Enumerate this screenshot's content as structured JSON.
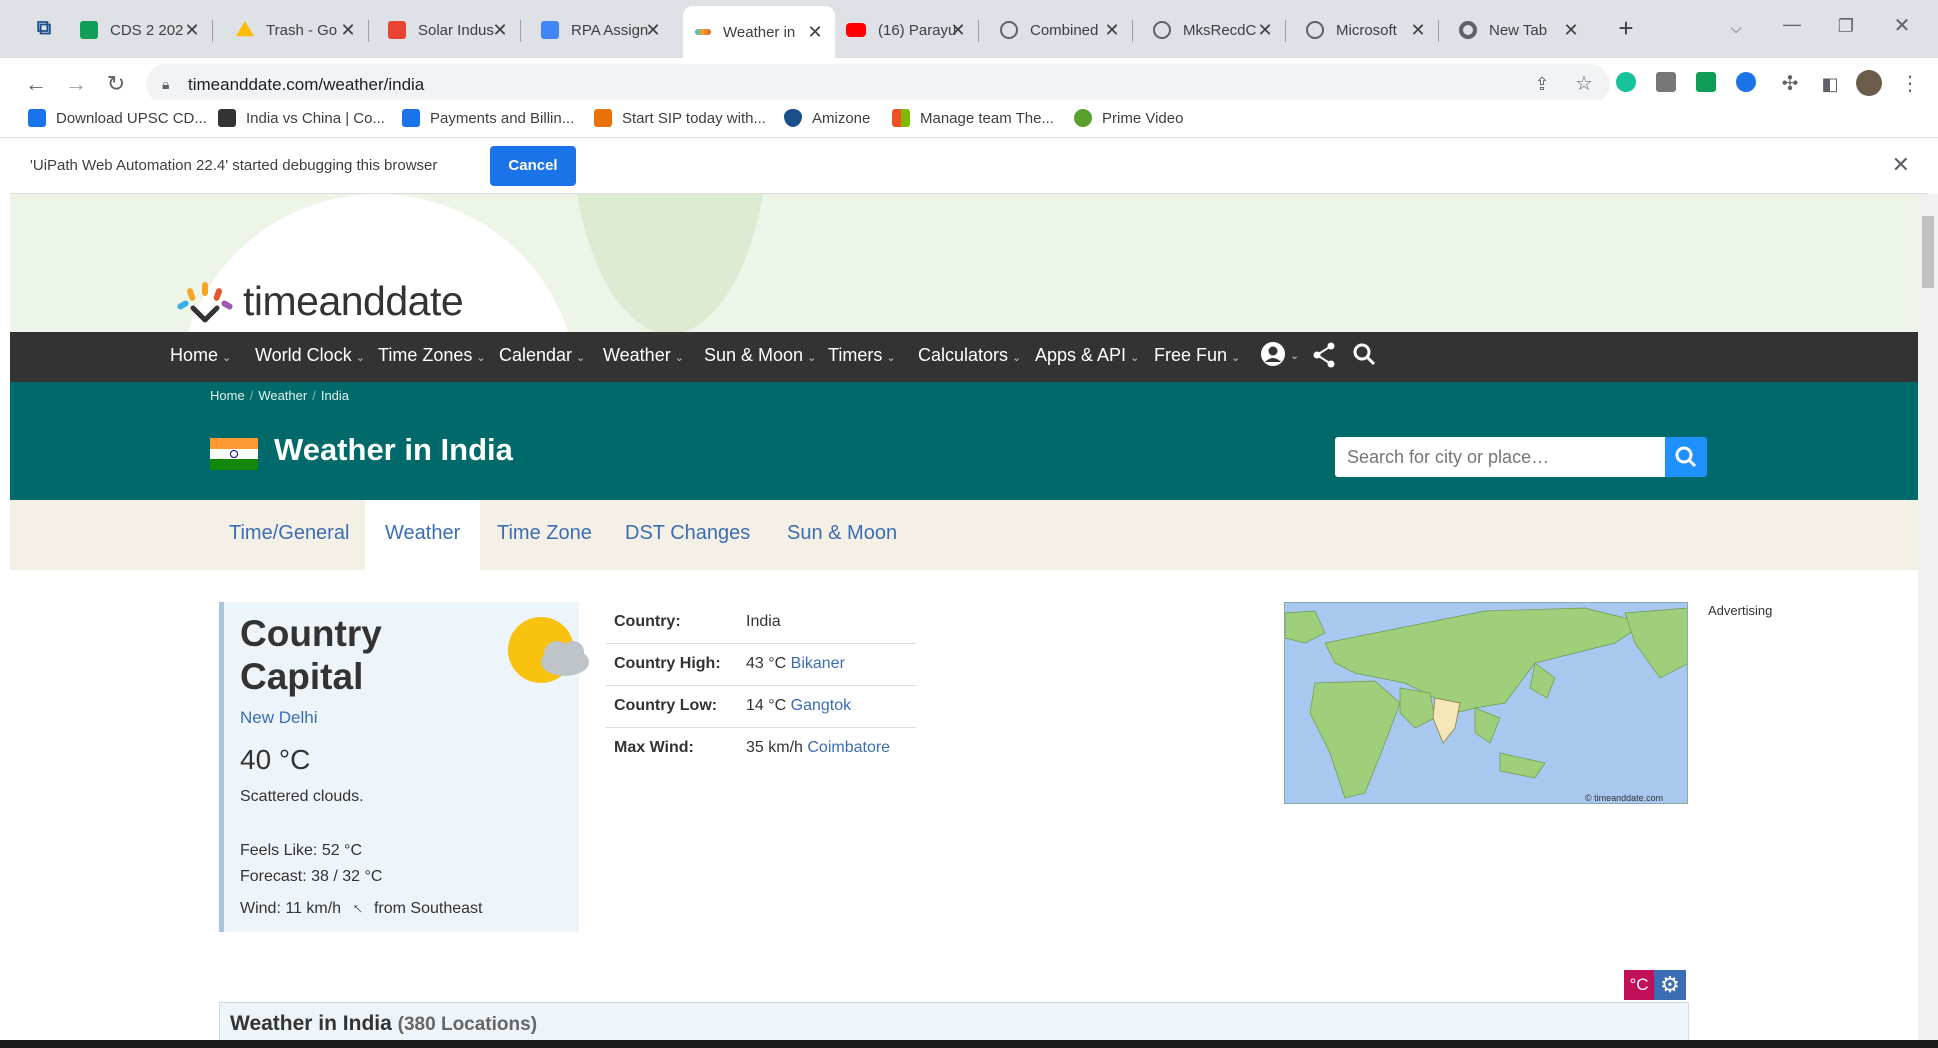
{
  "browser": {
    "tabs": [
      {
        "label": "CDS 2 202",
        "icon": "sheets-icon",
        "color": "#0f9d58"
      },
      {
        "label": "Trash - Go",
        "icon": "drive-icon",
        "color": "#fbbc04"
      },
      {
        "label": "Solar Indus",
        "icon": "gmail-icon",
        "color": "#ea4335"
      },
      {
        "label": "RPA Assign",
        "icon": "docs-icon",
        "color": "#4285f4"
      },
      {
        "label": "Weather in",
        "icon": "timeanddate-icon",
        "color": "#f6a623",
        "active": true
      },
      {
        "label": "(16) Parayu",
        "icon": "youtube-icon",
        "color": "#ff0000"
      },
      {
        "label": "Combined",
        "icon": "globe-icon",
        "color": "#5f6368"
      },
      {
        "label": "MksRecdC",
        "icon": "globe-icon",
        "color": "#5f6368"
      },
      {
        "label": "Microsoft",
        "icon": "globe-icon",
        "color": "#5f6368"
      },
      {
        "label": "New Tab",
        "icon": "chrome-icon",
        "color": "#5f6368"
      }
    ],
    "new_tab": "+",
    "url": "timeanddate.com/weather/india"
  },
  "bookmarks": [
    {
      "label": "Download UPSC CD...",
      "color": "#1a73e8"
    },
    {
      "label": "India vs China | Co...",
      "color": "#333333"
    },
    {
      "label": "Payments and Billin...",
      "color": "#1a73e8"
    },
    {
      "label": "Start SIP today with...",
      "color": "#e8710a"
    },
    {
      "label": "Amizone",
      "color": "#1a4f8b"
    },
    {
      "label": "Manage team The...",
      "color": "#f25022"
    },
    {
      "label": "Prime Video",
      "color": "#5aa02c"
    }
  ],
  "debug": {
    "message": "'UiPath Web Automation 22.4' started debugging this browser",
    "cancel": "Cancel"
  },
  "site": {
    "logo": "timeanddate",
    "nav": [
      {
        "label": "Home"
      },
      {
        "label": "World Clock"
      },
      {
        "label": "Time Zones"
      },
      {
        "label": "Calendar"
      },
      {
        "label": "Weather"
      },
      {
        "label": "Sun & Moon"
      },
      {
        "label": "Timers"
      },
      {
        "label": "Calculators"
      },
      {
        "label": "Apps & API"
      },
      {
        "label": "Free Fun"
      }
    ],
    "breadcrumbs": [
      "Home",
      "Weather",
      "India"
    ],
    "title": "Weather in India",
    "search_placeholder": "Search for city or place…",
    "subtabs": [
      "Time/General",
      "Weather",
      "Time Zone",
      "DST Changes",
      "Sun & Moon"
    ],
    "advertising": "Advertising"
  },
  "capital_card": {
    "title": "Country Capital",
    "city": "New Delhi",
    "temperature": "40 °C",
    "condition": "Scattered clouds.",
    "feels_like": "Feels Like: 52 °C",
    "forecast": "Forecast: 38 / 32 °C",
    "wind_prefix": "Wind: 11 km/h",
    "wind_arrow": "↑",
    "wind_suffix": "from Southeast"
  },
  "country_info": [
    {
      "key": "Country:",
      "value": "India",
      "link": ""
    },
    {
      "key": "Country High:",
      "value": "43 °C",
      "link": "Bikaner"
    },
    {
      "key": "Country Low:",
      "value": "14 °C",
      "link": "Gangtok"
    },
    {
      "key": "Max Wind:",
      "value": "35 km/h",
      "link": "Coimbatore"
    }
  ],
  "map_credit": "© timeanddate.com",
  "units": {
    "celsius": "°C"
  },
  "list": {
    "title": "Weather in India",
    "count": "(380 Locations)"
  },
  "colors": {
    "teal": "#006a6a",
    "nav": "#333333",
    "link": "#3b6db5",
    "accent_blue": "#1e90ff"
  }
}
